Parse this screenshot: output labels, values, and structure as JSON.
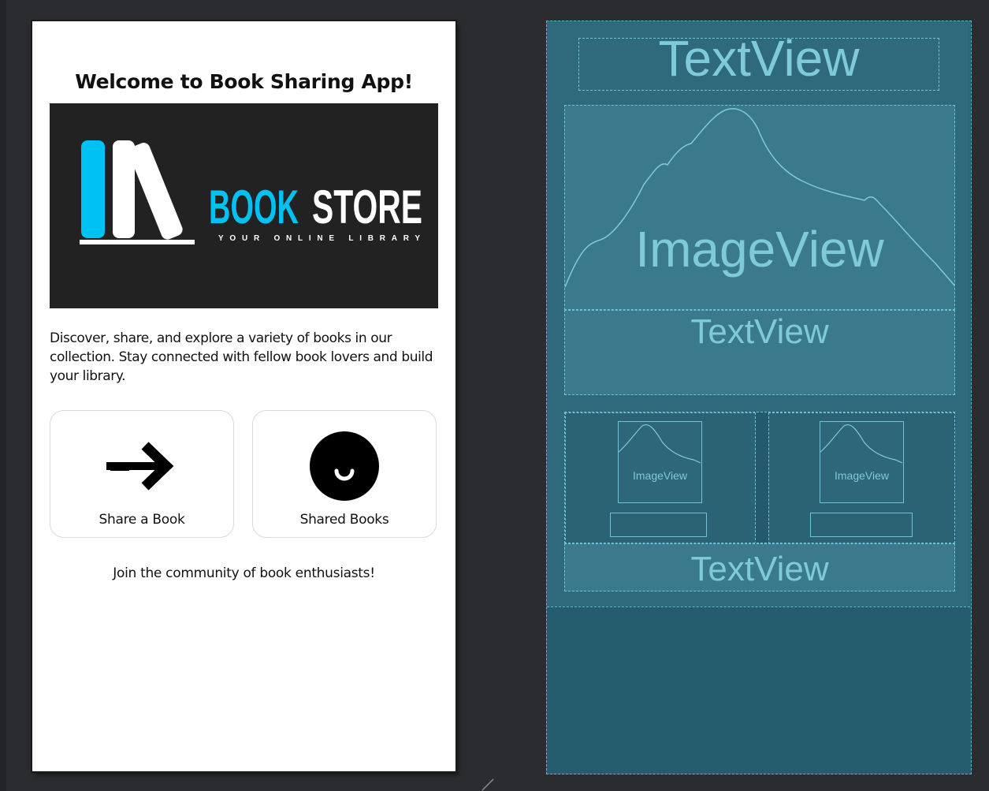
{
  "design": {
    "title": "Welcome to Book Sharing App!",
    "banner": {
      "brand_part1": "BOOK",
      "brand_part2": "STORE",
      "tagline": "YOUR ONLINE LIBRARY",
      "colors": {
        "accent": "#00c2f2",
        "background": "#222222",
        "text": "#ffffff"
      }
    },
    "description": "Discover, share, and explore a variety of books in our collection. Stay connected with fellow book lovers and build your library.",
    "buttons": [
      {
        "label": "Share a Book",
        "icon": "arrow-right-icon"
      },
      {
        "label": "Shared Books",
        "icon": "smile-circle-icon"
      }
    ],
    "footer": "Join the community of book enthusiasts!"
  },
  "blueprint": {
    "title_placeholder": "TextView",
    "image_placeholder": "ImageView",
    "description_placeholder": "TextView",
    "small_image_left": "ImageView",
    "small_image_right": "ImageView",
    "footer_placeholder": "TextView",
    "colors": {
      "background": "#255c6e",
      "outline": "#6fc3d8",
      "text": "#7ec9da"
    }
  }
}
